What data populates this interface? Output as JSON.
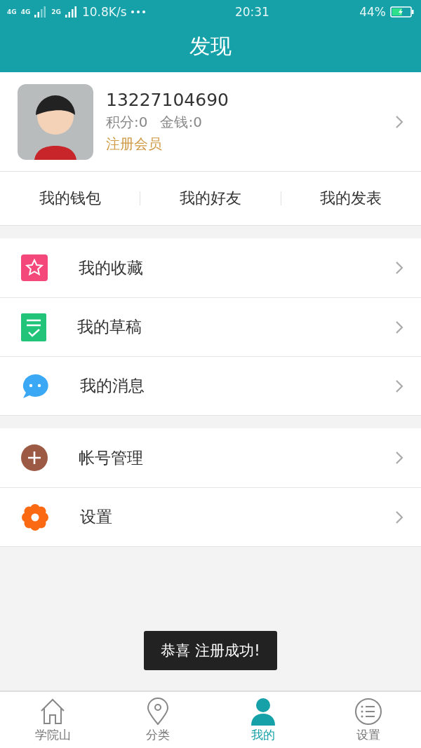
{
  "status_bar": {
    "network_1": "4G",
    "network_2": "4G",
    "network_3": "2G",
    "speed": "10.8K/s",
    "time": "20:31",
    "battery": "44%"
  },
  "header": {
    "title": "发现"
  },
  "profile": {
    "name": "13227104690",
    "points": "积分:0",
    "money": "金钱:0",
    "membership": "注册会员"
  },
  "quick_links": [
    "我的钱包",
    "我的好友",
    "我的发表"
  ],
  "menu_groups": [
    [
      {
        "label": "我的收藏"
      },
      {
        "label": "我的草稿"
      },
      {
        "label": "我的消息"
      }
    ],
    [
      {
        "label": "帐号管理"
      },
      {
        "label": "设置"
      }
    ]
  ],
  "toast": "恭喜 注册成功!",
  "tabs": [
    {
      "label": "学院山",
      "selected": false
    },
    {
      "label": "分类",
      "selected": false
    },
    {
      "label": "我的",
      "selected": true
    },
    {
      "label": "设置",
      "selected": false
    }
  ]
}
